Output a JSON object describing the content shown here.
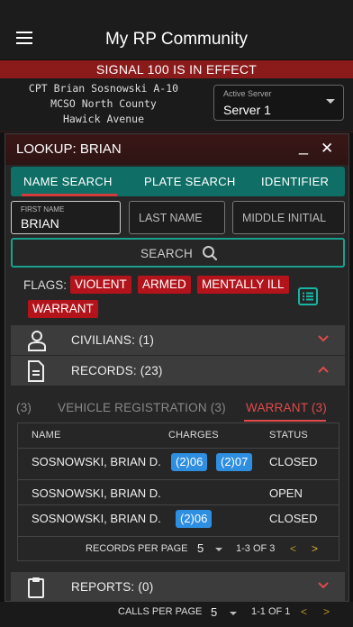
{
  "app": {
    "title": "My RP Community"
  },
  "signal_banner": "SIGNAL 100 IS IN EFFECT",
  "officer": {
    "line1": "CPT Brian Sosnowski A-10",
    "line2": "MCSO North County",
    "line3": "Hawick Avenue"
  },
  "server": {
    "label": "Active Server",
    "value": "Server 1"
  },
  "modal": {
    "title": "LOOKUP: BRIAN",
    "minimize": "_",
    "close": "✕",
    "tabs": [
      "NAME SEARCH",
      "PLATE SEARCH",
      "IDENTIFIER"
    ],
    "fields": {
      "first_name_label": "FIRST NAME",
      "first_name_value": "BRIAN",
      "last_name_placeholder": "LAST NAME",
      "middle_initial_placeholder": "MIDDLE INITIAL"
    },
    "search_label": "SEARCH",
    "flags_label": "FLAGS:",
    "flags": [
      "VIOLENT",
      "ARMED",
      "MENTALLY ILL",
      "WARRANT"
    ],
    "sections": {
      "civilians": "CIVILIANS: (1)",
      "records": "RECORDS: (23)",
      "reports": "REPORTS: (0)"
    },
    "record_tabs": [
      "(3)",
      "VEHICLE REGISTRATION (3)",
      "WARRANT (3)"
    ],
    "table": {
      "headers": [
        "NAME",
        "CHARGES",
        "STATUS"
      ],
      "rows": [
        {
          "name": "SOSNOWSKI, BRIAN D.",
          "charges": [
            "(2)06",
            "(2)07"
          ],
          "status": "CLOSED"
        },
        {
          "name": "SOSNOWSKI, BRIAN D.",
          "charges": [],
          "status": "OPEN"
        },
        {
          "name": "SOSNOWSKI, BRIAN D.",
          "charges": [
            "(2)06"
          ],
          "status": "CLOSED"
        }
      ],
      "pager": {
        "label": "RECORDS PER PAGE",
        "value": "5",
        "range": "1-3 OF 3",
        "prev": "<",
        "next": ">"
      }
    }
  },
  "bottom_bar": {
    "label": "CALLS PER PAGE",
    "value": "5",
    "range": "1-1 OF 1",
    "prev": "<",
    "next": ">"
  },
  "colors": {
    "accent_teal": "#0f6f66",
    "flag_red": "#b3141c",
    "chip_blue": "#2e8ee0",
    "warrant_tab": "#e04a4a"
  }
}
